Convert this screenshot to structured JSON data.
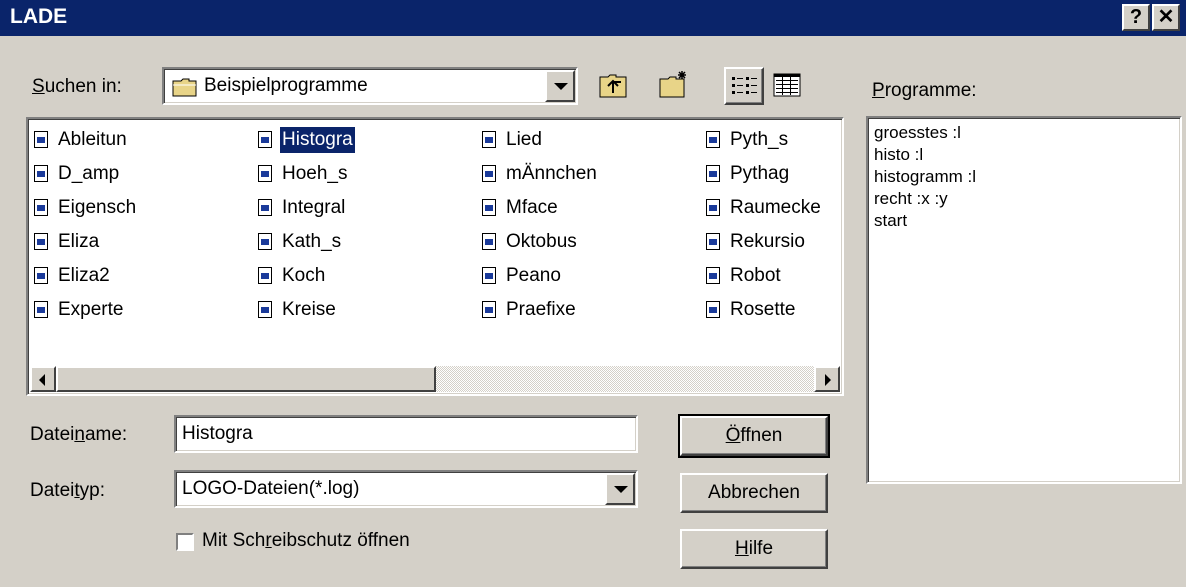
{
  "window": {
    "title": "LADE",
    "help_button": "?",
    "close_button": "✕"
  },
  "look_in": {
    "label_pre": "",
    "label_u": "S",
    "label_post": "uchen in:",
    "value": "Beispielprogramme"
  },
  "files": {
    "columns": [
      [
        "Ableitun",
        "D_amp",
        "Eigensch",
        "Eliza",
        "Eliza2",
        "Experte"
      ],
      [
        "Histogra",
        "Hoeh_s",
        "Integral",
        "Kath_s",
        "Koch",
        "Kreise"
      ],
      [
        "Lied",
        "mÄnnchen",
        "Mface",
        "Oktobus",
        "Peano",
        "Praefixe"
      ],
      [
        "Pyth_s",
        "Pythag",
        "Raumecke",
        "Rekursio",
        "Robot",
        "Rosette"
      ]
    ],
    "selected": "Histogra"
  },
  "programs": {
    "label_pre": "",
    "label_u": "P",
    "label_post": "rogramme:",
    "items": [
      "groesstes :l",
      "histo :l",
      "histogramm :l",
      "recht :x :y",
      "start"
    ]
  },
  "filename": {
    "label_pre": "Datei",
    "label_u": "n",
    "label_post": "ame:",
    "value": "Histogra"
  },
  "filetype": {
    "label_pre": "Datei",
    "label_u": "t",
    "label_post": "yp:",
    "value": "LOGO-Dateien(*.log)"
  },
  "readonly": {
    "label_pre": "Mit Sch",
    "label_u": "r",
    "label_post": "eibschutz öffnen",
    "checked": false
  },
  "buttons": {
    "open": {
      "pre": "",
      "u": "Ö",
      "post": "ffnen"
    },
    "cancel": {
      "pre": "Abbrechen",
      "u": "",
      "post": ""
    },
    "help": {
      "pre": "",
      "u": "H",
      "post": "ilfe"
    }
  },
  "colors": {
    "titlebar": "#0a246a",
    "face": "#d4d0c8",
    "selection": "#0a246a"
  }
}
